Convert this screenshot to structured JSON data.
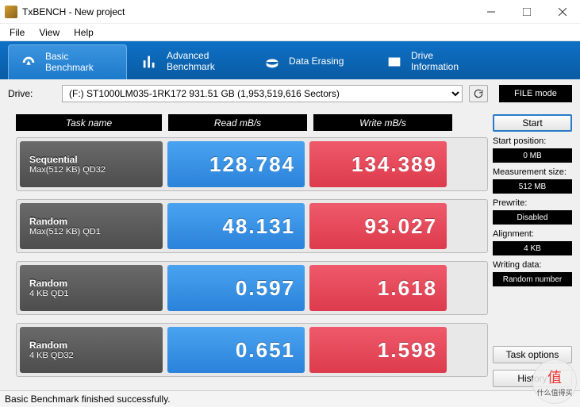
{
  "window": {
    "title": "TxBENCH - New project"
  },
  "menu": {
    "file": "File",
    "view": "View",
    "help": "Help"
  },
  "tabs": {
    "basic": "Basic\nBenchmark",
    "advanced": "Advanced\nBenchmark",
    "erasing": "Data Erasing",
    "driveinfo": "Drive\nInformation"
  },
  "drivebar": {
    "label": "Drive:",
    "selected": "(F:) ST1000LM035-1RK172   931.51 GB (1,953,519,616 Sectors)",
    "filemode": "FILE mode"
  },
  "headers": {
    "task": "Task name",
    "read": "Read mB/s",
    "write": "Write mB/s"
  },
  "rows": [
    {
      "name1": "Sequential",
      "name2": "Max(512 KB) QD32",
      "read": "128.784",
      "write": "134.389"
    },
    {
      "name1": "Random",
      "name2": "Max(512 KB) QD1",
      "read": "48.131",
      "write": "93.027"
    },
    {
      "name1": "Random",
      "name2": "4 KB QD1",
      "read": "0.597",
      "write": "1.618"
    },
    {
      "name1": "Random",
      "name2": "4 KB QD32",
      "read": "0.651",
      "write": "1.598"
    }
  ],
  "side": {
    "start": "Start",
    "startpos_label": "Start position:",
    "startpos_value": "0 MB",
    "meas_label": "Measurement size:",
    "meas_value": "512 MB",
    "prewrite_label": "Prewrite:",
    "prewrite_value": "Disabled",
    "align_label": "Alignment:",
    "align_value": "4 KB",
    "writedata_label": "Writing data:",
    "writedata_value": "Random number",
    "taskoptions": "Task options",
    "history": "History"
  },
  "status": "Basic Benchmark finished successfully.",
  "watermark": {
    "top": "值",
    "bottom": "什么值得买"
  }
}
